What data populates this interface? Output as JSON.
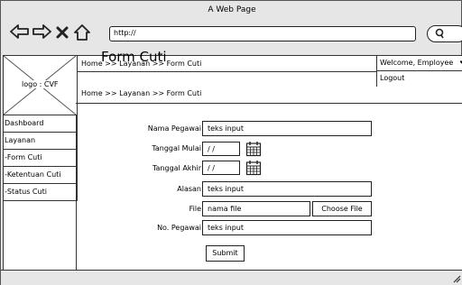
{
  "window": {
    "title": "A Web Page",
    "url": "http://"
  },
  "icons": {
    "back": "arrow-left-icon",
    "forward": "arrow-right-icon",
    "stop": "x-icon",
    "home": "home-icon",
    "search": "search-icon",
    "calendar": "calendar-icon",
    "resize": "resize-grip-icon"
  },
  "logo": {
    "label": "logo : CVF"
  },
  "header": {
    "breadcrumb": "Home >> Layanan >> Form Cuti",
    "breadcrumb_secondary": "Home >> Layanan >> Form Cuti",
    "user_menu": {
      "welcome": "Welcome, Employee",
      "arrow": "▾",
      "logout": "Logout"
    }
  },
  "sidebar": {
    "items": [
      {
        "label": "Dashboard"
      },
      {
        "label": "Layanan"
      },
      {
        "label": "-Form Cuti"
      },
      {
        "label": "-Ketentuan Cuti"
      },
      {
        "label": "-Status Cuti"
      }
    ]
  },
  "form": {
    "title": "Form Cuti",
    "nama_pegawai": {
      "label": "Nama Pegawai",
      "value": "teks input"
    },
    "tanggal_mulai": {
      "label": "Tanggal Mulai",
      "value": "/ /"
    },
    "tanggal_akhir": {
      "label": "Tanggal Akhir",
      "value": "/ /"
    },
    "alasan": {
      "label": "Alasan",
      "value": "teks input"
    },
    "file": {
      "label": "File",
      "value": "nama file",
      "button": "Choose File"
    },
    "no_pegawai": {
      "label": "No. Pegawai",
      "value": "teks input"
    },
    "submit": "Submit"
  }
}
